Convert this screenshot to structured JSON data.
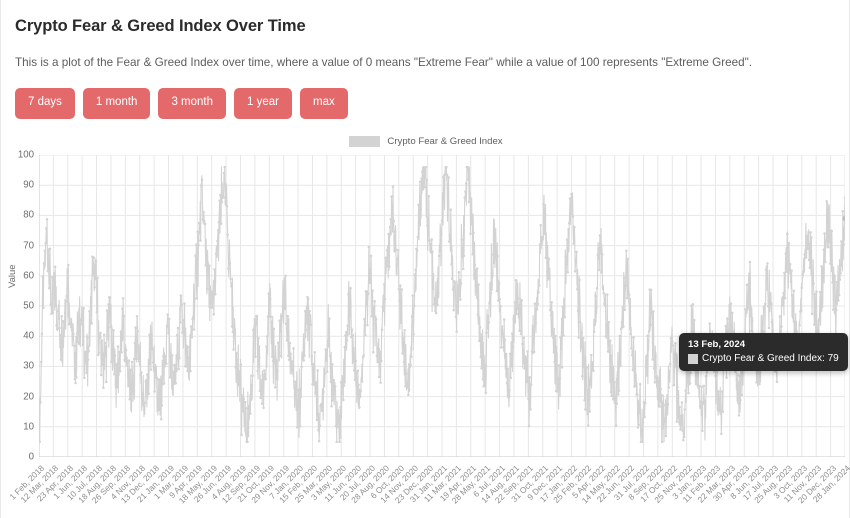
{
  "header": {
    "title": "Crypto Fear & Greed Index Over Time",
    "subtitle": "This is a plot of the Fear & Greed Index over time, where a value of 0 means \"Extreme Fear\" while a value of 100 represents \"Extreme Greed\"."
  },
  "range_buttons": [
    {
      "label": "7 days",
      "name": "range-button-7-days"
    },
    {
      "label": "1 month",
      "name": "range-button-1-month"
    },
    {
      "label": "3 month",
      "name": "range-button-3-month"
    },
    {
      "label": "1 year",
      "name": "range-button-1-year"
    },
    {
      "label": "max",
      "name": "range-button-max"
    }
  ],
  "colors": {
    "button": "#e4696b",
    "button_text": "#ffffff",
    "series": "#d3d3d3",
    "grid": "#e7e7e7",
    "axis": "#c9c9c9",
    "tooltip_bg": "#2b2b2b"
  },
  "legend": {
    "label": "Crypto Fear & Greed Index",
    "swatch_color": "#d3d3d3",
    "position": "top-center"
  },
  "tooltip": {
    "visible": true,
    "date": "13 Feb, 2024",
    "series_label": "Crypto Fear & Greed Index",
    "value": 79,
    "row_text": "Crypto Fear & Greed Index: 79",
    "swatch_color": "#d3d3d3"
  },
  "chart_data": {
    "type": "line",
    "title": "Crypto Fear & Greed Index Over Time",
    "subtitle": "This is a plot of the Fear & Greed Index over time, where a value of 0 means \"Extreme Fear\" while a value of 100 represents \"Extreme Greed\".",
    "xlabel": "",
    "ylabel": "Value",
    "ylim": [
      0,
      100
    ],
    "yticks": [
      0,
      10,
      20,
      30,
      40,
      50,
      60,
      70,
      80,
      90,
      100
    ],
    "grid": true,
    "marker": "circle",
    "line_color": "#d3d3d3",
    "legend_position": "top-center",
    "x_range": [
      "1 Feb, 2018",
      "13 Feb, 2024"
    ],
    "xticks": [
      "1 Feb, 2018",
      "12 Mar, 2018",
      "23 Apr, 2018",
      "1 Jun, 2018",
      "10 Jul, 2018",
      "18 Aug, 2018",
      "26 Sep, 2018",
      "4 Nov, 2018",
      "13 Dec, 2018",
      "21 Jan, 2019",
      "1 Mar, 2019",
      "9 Apr, 2019",
      "18 May, 2019",
      "26 Jun, 2019",
      "4 Aug, 2019",
      "12 Sep, 2019",
      "21 Oct, 2019",
      "29 Nov, 2019",
      "7 Jan, 2020",
      "15 Feb, 2020",
      "25 Mar, 2020",
      "3 May, 2020",
      "11 Jun, 2020",
      "20 Jul, 2020",
      "28 Aug, 2020",
      "6 Oct, 2020",
      "14 Nov, 2020",
      "23 Dec, 2020",
      "31 Jan, 2021",
      "11 Mar, 2021",
      "19 Apr, 2021",
      "28 May, 2021",
      "6 Jul, 2021",
      "14 Aug, 2021",
      "22 Sep, 2021",
      "31 Oct, 2021",
      "9 Dec, 2021",
      "17 Jan, 2022",
      "25 Feb, 2022",
      "5 Apr, 2022",
      "14 May, 2022",
      "22 Jun, 2022",
      "31 Jul, 2022",
      "8 Sep, 2022",
      "17 Oct, 2022",
      "25 Nov, 2022",
      "3 Jan, 2023",
      "11 Feb, 2023",
      "22 Mar, 2023",
      "30 Apr, 2023",
      "8 Jun, 2023",
      "17 Jul, 2023",
      "25 Aug, 2023",
      "3 Oct, 2023",
      "11 Nov, 2023",
      "20 Dec, 2023",
      "28 Jan, 2024"
    ],
    "series": [
      {
        "name": "Crypto Fear & Greed Index",
        "note": "Daily index values 0-100 from 1 Feb 2018 to 13 Feb 2024; values sampled at regular intervals across the plotted span.",
        "values": [
          8,
          22,
          40,
          55,
          62,
          74,
          71,
          66,
          55,
          47,
          52,
          58,
          54,
          47,
          43,
          40,
          38,
          44,
          50,
          55,
          58,
          52,
          44,
          39,
          35,
          31,
          36,
          42,
          47,
          50,
          44,
          38,
          33,
          30,
          34,
          41,
          48,
          56,
          63,
          60,
          52,
          45,
          40,
          36,
          32,
          29,
          33,
          38,
          44,
          49,
          43,
          36,
          31,
          27,
          24,
          28,
          34,
          40,
          45,
          41,
          35,
          30,
          26,
          22,
          19,
          24,
          30,
          36,
          41,
          38,
          32,
          27,
          23,
          20,
          18,
          23,
          28,
          34,
          39,
          36,
          30,
          25,
          21,
          18,
          15,
          20,
          26,
          32,
          38,
          43,
          40,
          34,
          29,
          25,
          22,
          27,
          33,
          39,
          45,
          50,
          47,
          41,
          36,
          32,
          29,
          33,
          40,
          47,
          54,
          60,
          66,
          72,
          78,
          84,
          80,
          73,
          66,
          60,
          55,
          50,
          46,
          52,
          58,
          64,
          70,
          76,
          82,
          88,
          94,
          90,
          82,
          74,
          66,
          58,
          50,
          44,
          39,
          34,
          30,
          26,
          22,
          18,
          14,
          10,
          6,
          11,
          17,
          23,
          29,
          35,
          41,
          38,
          33,
          28,
          24,
          20,
          25,
          31,
          37,
          43,
          48,
          44,
          38,
          33,
          29,
          25,
          30,
          36,
          42,
          48,
          54,
          50,
          44,
          39,
          35,
          31,
          27,
          23,
          20,
          17,
          14,
          19,
          25,
          31,
          37,
          43,
          49,
          45,
          39,
          34,
          30,
          26,
          22,
          18,
          15,
          12,
          17,
          23,
          29,
          35,
          41,
          38,
          33,
          28,
          24,
          20,
          16,
          13,
          10,
          15,
          21,
          27,
          33,
          39,
          45,
          51,
          47,
          41,
          36,
          32,
          28,
          24,
          20,
          25,
          31,
          38,
          44,
          50,
          56,
          62,
          58,
          52,
          46,
          41,
          37,
          33,
          29,
          35,
          42,
          48,
          54,
          60,
          66,
          72,
          78,
          84,
          80,
          73,
          66,
          60,
          54,
          48,
          42,
          37,
          33,
          29,
          25,
          30,
          37,
          44,
          51,
          58,
          65,
          72,
          79,
          86,
          92,
          95,
          91,
          85,
          78,
          71,
          64,
          58,
          52,
          47,
          53,
          60,
          67,
          74,
          81,
          88,
          94,
          90,
          83,
          76,
          69,
          62,
          56,
          50,
          45,
          51,
          58,
          65,
          72,
          79,
          86,
          93,
          95,
          88,
          80,
          72,
          65,
          58,
          52,
          46,
          41,
          36,
          31,
          27,
          33,
          40,
          47,
          54,
          61,
          68,
          74,
          70,
          63,
          56,
          50,
          44,
          39,
          34,
          30,
          26,
          22,
          27,
          33,
          40,
          46,
          52,
          58,
          54,
          48,
          42,
          37,
          32,
          28,
          24,
          20,
          25,
          31,
          37,
          43,
          49,
          55,
          61,
          67,
          73,
          79,
          75,
          68,
          61,
          54,
          48,
          42,
          37,
          32,
          28,
          24,
          29,
          36,
          43,
          50,
          57,
          64,
          71,
          78,
          85,
          81,
          74,
          67,
          60,
          53,
          47,
          41,
          36,
          31,
          27,
          23,
          19,
          24,
          30,
          37,
          44,
          51,
          58,
          65,
          72,
          68,
          61,
          54,
          48,
          42,
          37,
          32,
          28,
          24,
          20,
          16,
          21,
          27,
          34,
          41,
          48,
          55,
          62,
          58,
          51,
          45,
          39,
          34,
          30,
          26,
          22,
          18,
          14,
          11,
          16,
          22,
          28,
          35,
          42,
          49,
          45,
          39,
          34,
          29,
          25,
          21,
          17,
          13,
          10,
          8,
          13,
          19,
          25,
          31,
          37,
          33,
          28,
          24,
          20,
          17,
          14,
          11,
          9,
          14,
          20,
          26,
          32,
          38,
          44,
          40,
          35,
          30,
          26,
          22,
          19,
          16,
          13,
          18,
          24,
          30,
          36,
          42,
          38,
          33,
          28,
          24,
          21,
          18,
          15,
          20,
          26,
          32,
          38,
          44,
          50,
          46,
          40,
          35,
          31,
          27,
          24,
          21,
          26,
          32,
          38,
          44,
          50,
          56,
          52,
          46,
          41,
          36,
          32,
          28,
          25,
          30,
          36,
          42,
          48,
          54,
          60,
          56,
          50,
          45,
          40,
          36,
          32,
          29,
          34,
          40,
          46,
          52,
          58,
          64,
          70,
          66,
          60,
          54,
          49,
          44,
          40,
          36,
          41,
          47,
          53,
          59,
          65,
          71,
          77,
          73,
          66,
          60,
          54,
          49,
          44,
          40,
          45,
          51,
          57,
          63,
          69,
          75,
          79,
          74,
          68,
          62,
          57,
          52,
          48,
          53,
          59,
          65,
          71,
          77,
          79
        ]
      }
    ]
  },
  "axes": {
    "y_title": "Value"
  }
}
